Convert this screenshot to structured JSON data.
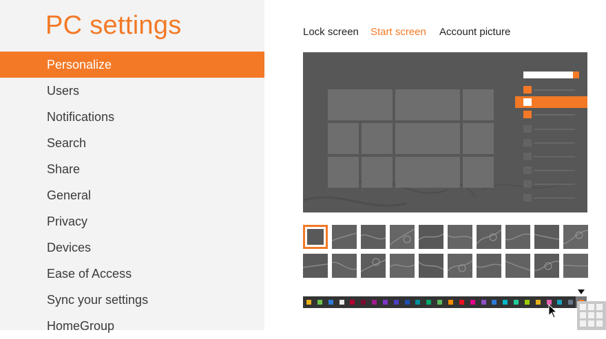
{
  "app": {
    "title": "PC settings"
  },
  "nav": {
    "items": [
      {
        "label": "Personalize",
        "selected": true
      },
      {
        "label": "Users"
      },
      {
        "label": "Notifications"
      },
      {
        "label": "Search"
      },
      {
        "label": "Share"
      },
      {
        "label": "General"
      },
      {
        "label": "Privacy"
      },
      {
        "label": "Devices"
      },
      {
        "label": "Ease of Access"
      },
      {
        "label": "Sync your settings"
      },
      {
        "label": "HomeGroup"
      }
    ]
  },
  "tabs": [
    {
      "label": "Lock screen"
    },
    {
      "label": "Start screen",
      "active": true
    },
    {
      "label": "Account picture"
    }
  ],
  "colors": {
    "accent": "#f37926",
    "nav_background": "#f3f3f3",
    "preview_background": "#575757",
    "tile": "#6e6e6e"
  },
  "background_patterns": {
    "count": 20,
    "selected_index": 0
  },
  "color_swatches": {
    "selected_index": 25,
    "values": [
      "#f3b21a",
      "#6cc24a",
      "#2c7ad6",
      "#e8e8e8",
      "#b3002f",
      "#7a0b30",
      "#a11a8c",
      "#7e35c7",
      "#4b3fc0",
      "#1f4fb0",
      "#008d9c",
      "#00a86b",
      "#5cb85c",
      "#ff8c00",
      "#e81123",
      "#e3008c",
      "#8e4ec6",
      "#2d7ad6",
      "#00b7c3",
      "#1fcc96",
      "#99cc00",
      "#e8b11b",
      "#e85fb0",
      "#19a2bd",
      "#68768a",
      "#f37926"
    ]
  }
}
